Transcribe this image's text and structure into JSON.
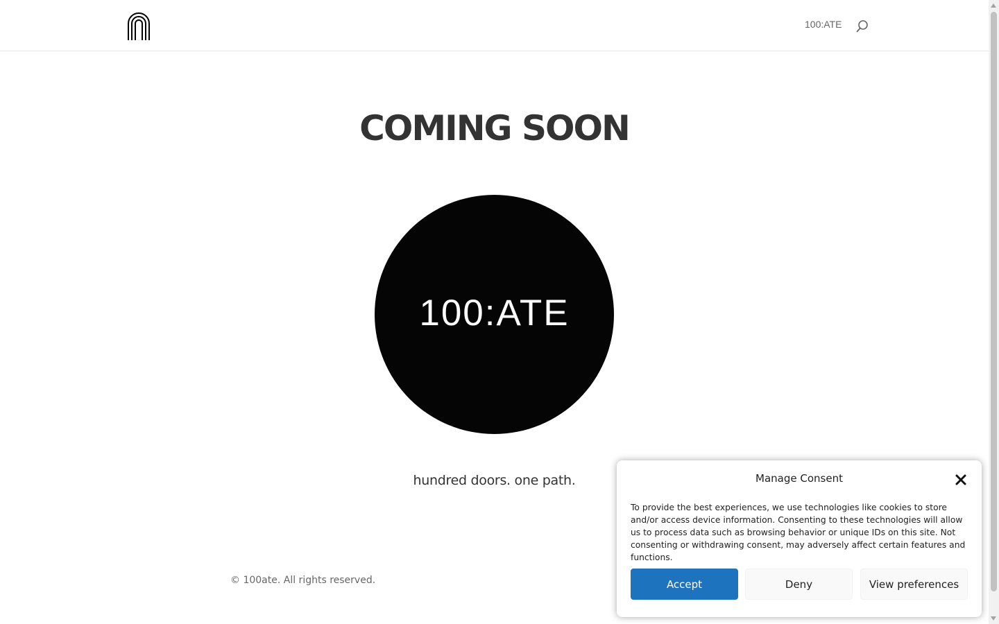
{
  "header": {
    "nav_link": "100:ATE"
  },
  "hero": {
    "title": "COMING SOON",
    "brand": "100:ATE",
    "tagline": "hundred doors. one path."
  },
  "footer": {
    "copyright": "© 100ate. All rights reserved."
  },
  "consent": {
    "title": "Manage Consent",
    "body": "To provide the best experiences, we use technologies like cookies to store and/or access device information. Consenting to these technologies will allow us to process data such as browsing behavior or unique IDs on this site. Not consenting or withdrawing consent, may adversely affect certain features and functions.",
    "accept_label": "Accept",
    "deny_label": "Deny",
    "preferences_label": "View preferences"
  },
  "icons": {
    "logo": "arch-logo-icon",
    "search": "search-icon",
    "close": "close-icon"
  },
  "colors": {
    "accent": "#1e73be",
    "circle": "#050505",
    "text": "#333333"
  }
}
